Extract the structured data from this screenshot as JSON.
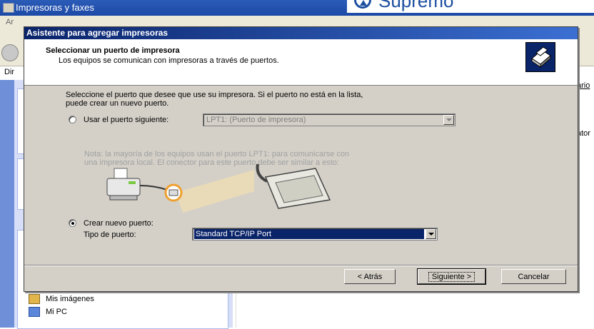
{
  "background": {
    "window_title": "Impresoras y faxes",
    "brand_name": "Supremo",
    "menu_fragment": "Ar",
    "address_fragment": "Dir",
    "right_label_1": "ario",
    "right_label_2": "ator",
    "folder_items": [
      {
        "label": "Mis imágenes",
        "icon": "pictures-folder-icon"
      },
      {
        "label": "Mi PC",
        "icon": "computer-icon"
      }
    ]
  },
  "dialog": {
    "title": "Asistente para agregar impresoras",
    "header_title": "Seleccionar un puerto de impresora",
    "header_subtitle": "Los equipos se comunican con impresoras a través de puertos.",
    "intro_line1": "Seleccione el puerto que desee que use su impresora. Si el puerto no está en la lista,",
    "intro_line2": "puede crear un nuevo puerto.",
    "use_port_label": "Usar el puerto siguiente:",
    "use_port_selected": false,
    "existing_port_value": "LPT1: (Puerto de impresora)",
    "note_line1": "Nota: la mayoría de los equipos usan el puerto LPT1: para comunicarse con",
    "note_line2": "una impresora local. El conector para este puerto debe ser similar a esto:",
    "create_port_label": "Crear nuevo puerto:",
    "create_port_selected": true,
    "port_type_label": "Tipo de puerto:",
    "port_type_value": "Standard TCP/IP Port",
    "buttons": {
      "back": "< Atrás",
      "next": "Siguiente >",
      "cancel": "Cancelar"
    },
    "colors": {
      "title_bar": "#0a246a",
      "face": "#d4d0c8",
      "selection": "#0a246a"
    }
  }
}
